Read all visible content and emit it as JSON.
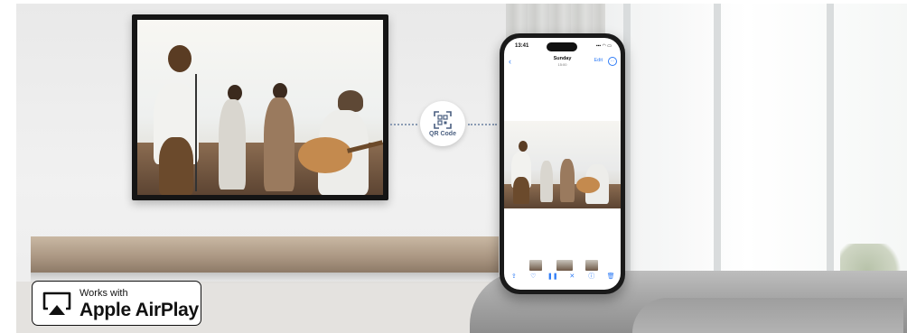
{
  "airplay_badge": {
    "line1": "Works with",
    "line2": "Apple AirPlay",
    "icon": "airplay-icon"
  },
  "qr_badge": {
    "label": "QR Code",
    "icon": "qr-code-icon"
  },
  "phone": {
    "status_time": "13:41",
    "status_icons": "▪▪▪ ◠ ▭",
    "nav": {
      "back_glyph": "‹",
      "title": "Sunday",
      "subtitle": "15:00",
      "edit_label": "Edit",
      "more_glyph": "···"
    },
    "toolbar": [
      {
        "name": "share-icon",
        "glyph": "⇪"
      },
      {
        "name": "heart-icon",
        "glyph": "♡"
      },
      {
        "name": "pause-icon",
        "glyph": "❚❚"
      },
      {
        "name": "mute-icon",
        "glyph": "✕"
      },
      {
        "name": "info-icon",
        "glyph": "ⓘ"
      },
      {
        "name": "trash-icon",
        "glyph": "🗑"
      }
    ]
  },
  "colors": {
    "accent_blue": "#2f7cf6",
    "qr_text": "#4a5f80",
    "tv_bezel": "#151515"
  }
}
